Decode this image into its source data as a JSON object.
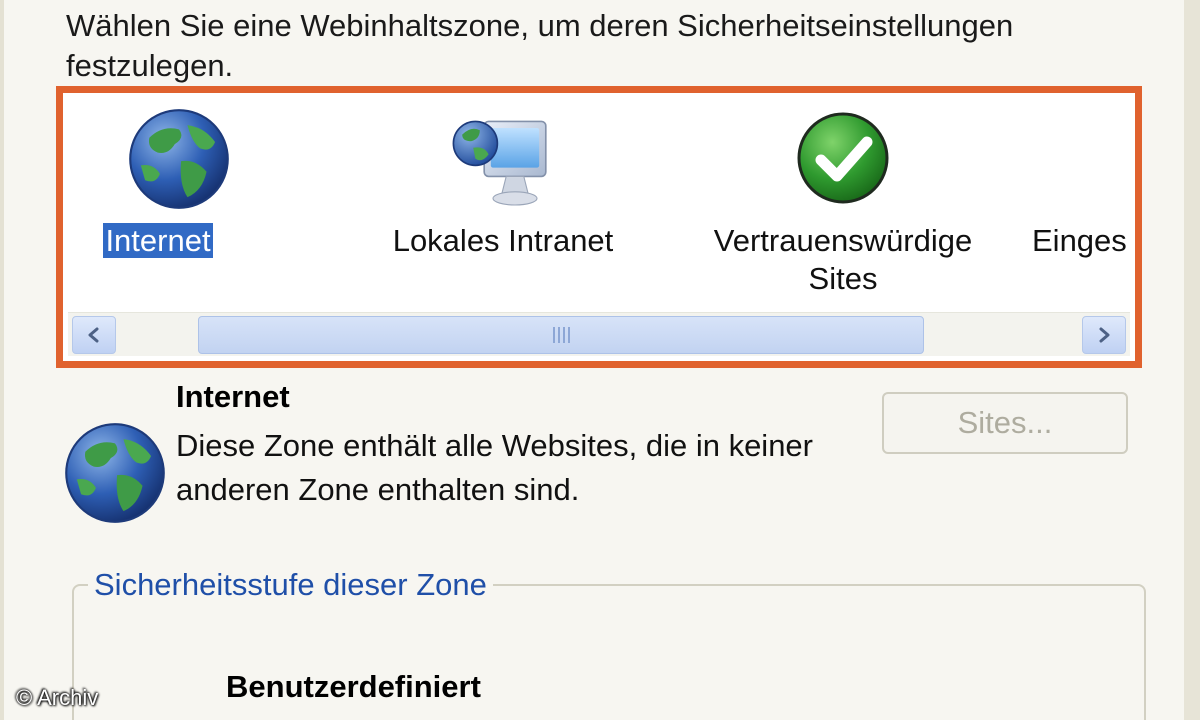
{
  "dialog": {
    "instruction": "Wählen Sie eine Webinhaltszone, um deren Sicherheitseinstellungen festzulegen."
  },
  "zones": [
    {
      "label": "Internet",
      "icon": "globe-icon",
      "selected": true
    },
    {
      "label": "Lokales Intranet",
      "icon": "intranet-monitor-icon",
      "selected": false
    },
    {
      "label": "Vertrauenswürdige Sites",
      "icon": "trusted-checkmark-icon",
      "selected": false
    },
    {
      "label": "Einges",
      "icon": "",
      "selected": false
    }
  ],
  "scrollbar": {
    "left_icon": "chevron-left-icon",
    "right_icon": "chevron-right-icon"
  },
  "selected_zone": {
    "title": "Internet",
    "description": "Diese Zone enthält alle Websites, die in keiner anderen Zone enthalten sind.",
    "icon": "globe-icon"
  },
  "buttons": {
    "sites_label": "Sites..."
  },
  "security_level": {
    "group_label": "Sicherheitsstufe dieser Zone",
    "level_name": "Benutzerdefiniert"
  },
  "watermark": "© Archiv",
  "colors": {
    "highlight_frame": "#e0622e",
    "selection": "#316ac5",
    "group_label": "#1f4fa8"
  }
}
